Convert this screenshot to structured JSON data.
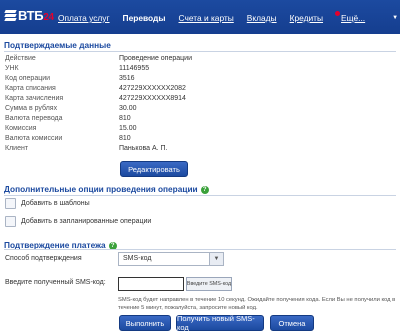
{
  "brand": {
    "name": "ВТБ",
    "suffix": "24"
  },
  "nav": {
    "items": [
      {
        "label": "Оплата услуг",
        "active": false
      },
      {
        "label": "Переводы",
        "active": true
      },
      {
        "label": "Счета и карты",
        "active": false
      },
      {
        "label": "Вклады",
        "active": false
      },
      {
        "label": "Кредиты",
        "active": false
      }
    ],
    "more_label": "Ещё..."
  },
  "confirmed": {
    "title": "Подтверждаемые данные",
    "rows": [
      {
        "key": "Действие",
        "value": "Проведение операции"
      },
      {
        "key": "УНК",
        "value": "11146955"
      },
      {
        "key": "Код операции",
        "value": "3516"
      },
      {
        "key": "Карта списания",
        "value": "427229XXXXXX2082"
      },
      {
        "key": "Карта зачисления",
        "value": "427229XXXXXX8914"
      },
      {
        "key": "Сумма в рублях",
        "value": "30.00"
      },
      {
        "key": "Валюта перевода",
        "value": "810"
      },
      {
        "key": "Комиссия",
        "value": "15.00"
      },
      {
        "key": "Валюта комиссии",
        "value": "810"
      },
      {
        "key": "Клиент",
        "value": "Панькова А. П."
      }
    ],
    "edit_button": "Редактировать"
  },
  "options": {
    "title": "Дополнительные опции проведения операции",
    "items": [
      {
        "label": "Добавить в шаблоны",
        "checked": false
      },
      {
        "label": "Добавить в запланированные операции",
        "checked": false
      }
    ]
  },
  "confirm": {
    "title": "Подтверждение платежа",
    "method_label": "Способ подтверждения",
    "method_value": "SMS-код",
    "code_label": "Введите полученный SMS-код:",
    "code_value": "",
    "code_hint_button": "Введите SMS-код",
    "note": "SMS-код будет направлен в течение 10 секунд. Ожидайте получения кода. Если Вы не получили код в течение 5 минут, пожалуйста, запросите новый код.",
    "buttons": {
      "execute": "Выполнить",
      "new_code": "Получить новый SMS-код",
      "cancel": "Отмена"
    }
  }
}
